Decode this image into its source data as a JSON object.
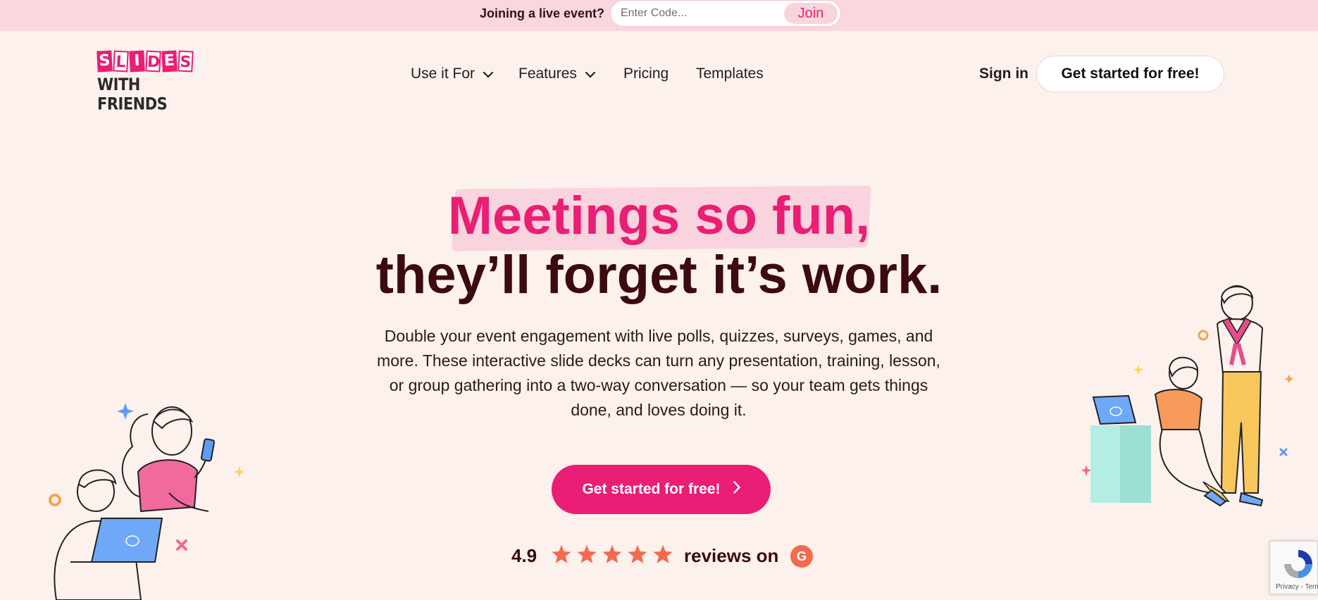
{
  "topbar": {
    "label": "Joining a live event?",
    "code_placeholder": "Enter Code...",
    "join_label": "Join"
  },
  "header": {
    "logo_letters": [
      "S",
      "L",
      "I",
      "D",
      "E",
      "S"
    ],
    "logo_line2": "WITH FRIENDS",
    "nav": [
      {
        "label": "Use it For",
        "has_dropdown": true
      },
      {
        "label": "Features",
        "has_dropdown": true
      },
      {
        "label": "Pricing",
        "has_dropdown": false
      },
      {
        "label": "Templates",
        "has_dropdown": false
      }
    ],
    "signin_label": "Sign in",
    "cta_label": "Get started for free!"
  },
  "hero": {
    "headline_line1": "Meetings so fun,",
    "headline_line2": "they’ll forget it’s work.",
    "subtext": "Double your event engagement with live polls, quizzes, surveys, games, and more. These interactive slide decks can turn any presentation, training, lesson, or group gathering into a two-way conversation — so your team gets things done, and loves doing it.",
    "cta_label": "Get started for free!",
    "rating": "4.9",
    "stars": 5,
    "reviews_label": "reviews on",
    "reviews_badge": "G"
  },
  "recaptcha": {
    "text": "Privacy - Terms"
  },
  "colors": {
    "brand_pink": "#e91e74",
    "dark_maroon": "#3c0a10",
    "page_bg": "#fcf1ec",
    "topbar_bg": "#f8d8de",
    "star_color": "#f26b4f"
  }
}
